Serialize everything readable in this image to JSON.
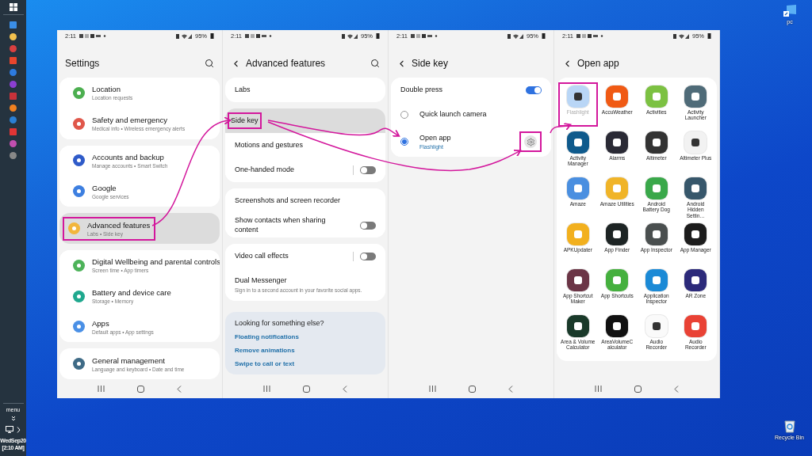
{
  "taskbar": {
    "menu_label": "menu",
    "date": "WedSep20",
    "time": "[2:10 AM]"
  },
  "desktop_icons": [
    {
      "kind": "computer",
      "label": "pc"
    },
    {
      "kind": "recycle_bin",
      "label": "Recycle Bin"
    }
  ],
  "screens": [
    {
      "kind": "settings",
      "status": {
        "time": "2:11",
        "battery": "95%"
      },
      "title": "Settings",
      "groups": [
        [
          {
            "title": "Location",
            "subtitle": "Location requests",
            "color": "#4caf50",
            "selected": false,
            "annotated": false
          },
          {
            "title": "Safety and emergency",
            "subtitle": "Medical info  •  Wireless emergency alerts",
            "color": "#e0574a",
            "selected": false,
            "annotated": false
          }
        ],
        [
          {
            "title": "Accounts and backup",
            "subtitle": "Manage accounts  •  Smart Switch",
            "color": "#2f5bc9",
            "selected": false,
            "annotated": false
          },
          {
            "title": "Google",
            "subtitle": "Google services",
            "color": "#3d7fe0",
            "selected": false,
            "annotated": false
          }
        ],
        [
          {
            "title": "Advanced features",
            "subtitle": "Labs  •  Side key",
            "color": "#f2b63c",
            "selected": true,
            "annotated": true
          }
        ],
        [
          {
            "title": "Digital Wellbeing and parental controls",
            "subtitle": "Screen time  •  App timers",
            "color": "#4db35a",
            "selected": false,
            "annotated": false
          },
          {
            "title": "Battery and device care",
            "subtitle": "Storage  •  Memory",
            "color": "#1fa88e",
            "selected": false,
            "annotated": false
          },
          {
            "title": "Apps",
            "subtitle": "Default apps  •  App settings",
            "color": "#4a90e6",
            "selected": false,
            "annotated": false
          }
        ],
        [
          {
            "title": "General management",
            "subtitle": "Language and keyboard  •  Date and time",
            "color": "#3f6b86",
            "selected": false,
            "annotated": false
          }
        ]
      ]
    },
    {
      "kind": "features",
      "status": {
        "time": "2:11",
        "battery": "95%"
      },
      "title": "Advanced features",
      "groups": [
        [
          {
            "kind": "plain",
            "label": "Labs",
            "selected": false,
            "annotated": false
          }
        ],
        [
          {
            "kind": "plain",
            "label": "Side key",
            "selected": true,
            "annotated": true
          },
          {
            "kind": "plain",
            "label": "Motions and gestures",
            "selected": false,
            "annotated": false
          },
          {
            "kind": "split_switch",
            "label": "One-handed mode",
            "on": false,
            "selected": false,
            "annotated": false
          }
        ],
        [
          {
            "kind": "plain",
            "label": "Screenshots and screen recorder",
            "selected": false,
            "annotated": false
          },
          {
            "kind": "switch",
            "label": "Show contacts when sharing content",
            "on": false,
            "selected": false,
            "annotated": false
          }
        ],
        [
          {
            "kind": "split_switch",
            "label": "Video call effects",
            "on": false,
            "selected": false,
            "annotated": false
          },
          {
            "kind": "plain",
            "label": "Dual Messenger",
            "subtitle": "Sign in to a second account in your favorite social apps.",
            "selected": false,
            "annotated": false
          }
        ]
      ],
      "suggestions": {
        "title": "Looking for something else?",
        "links": [
          "Floating notifications",
          "Remove animations",
          "Swipe to call or text"
        ]
      }
    },
    {
      "kind": "side_key",
      "status": {
        "time": "2:11",
        "battery": "95%"
      },
      "title": "Side key",
      "rows": [
        {
          "kind": "switch",
          "label": "Double press",
          "on": true
        },
        {
          "kind": "radio",
          "label": "Quick launch camera",
          "selected": false
        },
        {
          "kind": "radio_settings",
          "label": "Open app",
          "subtitle": "Flashlight",
          "selected": true,
          "annotated": true
        }
      ]
    },
    {
      "kind": "app_grid",
      "status": {
        "time": "2:11",
        "battery": "95%"
      },
      "title": "Open app",
      "apps": [
        {
          "label": "Flashlight",
          "color": "#b9d6f6",
          "selected": true,
          "annotated": true
        },
        {
          "label": "AccuWeather",
          "color": "#f05a14",
          "selected": false,
          "annotated": false
        },
        {
          "label": "Activities",
          "color": "#7cc142",
          "selected": false,
          "annotated": false
        },
        {
          "label": "Activity Launcher",
          "color": "#4f6b78",
          "selected": false,
          "annotated": false
        },
        {
          "label": "Activity Manager",
          "color": "#0f5a8c",
          "selected": false,
          "annotated": false
        },
        {
          "label": "Alarms",
          "color": "#2a2a35",
          "selected": false,
          "annotated": false
        },
        {
          "label": "Altimeter",
          "color": "#333333",
          "selected": false,
          "annotated": false
        },
        {
          "label": "Altimeter Plus",
          "color": "#f2f2f2",
          "selected": false,
          "annotated": false
        },
        {
          "label": "Amaze",
          "color": "#4a8fe0",
          "selected": false,
          "annotated": false
        },
        {
          "label": "Amaze Utilities",
          "color": "#f0b428",
          "selected": false,
          "annotated": false
        },
        {
          "label": "Android Battery Dog",
          "color": "#3aa84a",
          "selected": false,
          "annotated": false
        },
        {
          "label": "Android Hidden Settin…",
          "color": "#37576b",
          "selected": false,
          "annotated": false
        },
        {
          "label": "APKUpdater",
          "color": "#f2b01e",
          "selected": false,
          "annotated": false
        },
        {
          "label": "App Finder",
          "color": "#1d2424",
          "selected": false,
          "annotated": false
        },
        {
          "label": "App Inspector",
          "color": "#4a4f4f",
          "selected": false,
          "annotated": false
        },
        {
          "label": "App Manager",
          "color": "#1c1c1c",
          "selected": false,
          "annotated": false
        },
        {
          "label": "App Shortcut Maker",
          "color": "#6b3546",
          "selected": false,
          "annotated": false
        },
        {
          "label": "App Shortcuts",
          "color": "#45b03e",
          "selected": false,
          "annotated": false
        },
        {
          "label": "Application Inspector",
          "color": "#1b8ad6",
          "selected": false,
          "annotated": false
        },
        {
          "label": "AR Zone",
          "color": "#2c2a7a",
          "selected": false,
          "annotated": false
        },
        {
          "label": "Area & Volume Calculator",
          "color": "#1a3a2a",
          "selected": false,
          "annotated": false
        },
        {
          "label": "AreaVolumeCalculator",
          "color": "#111111",
          "selected": false,
          "annotated": false
        },
        {
          "label": "Audio Recorder",
          "color": "#fafafa",
          "selected": false,
          "annotated": false
        },
        {
          "label": "Audio Recorder",
          "color": "#e94235",
          "selected": false,
          "annotated": false
        }
      ]
    }
  ]
}
